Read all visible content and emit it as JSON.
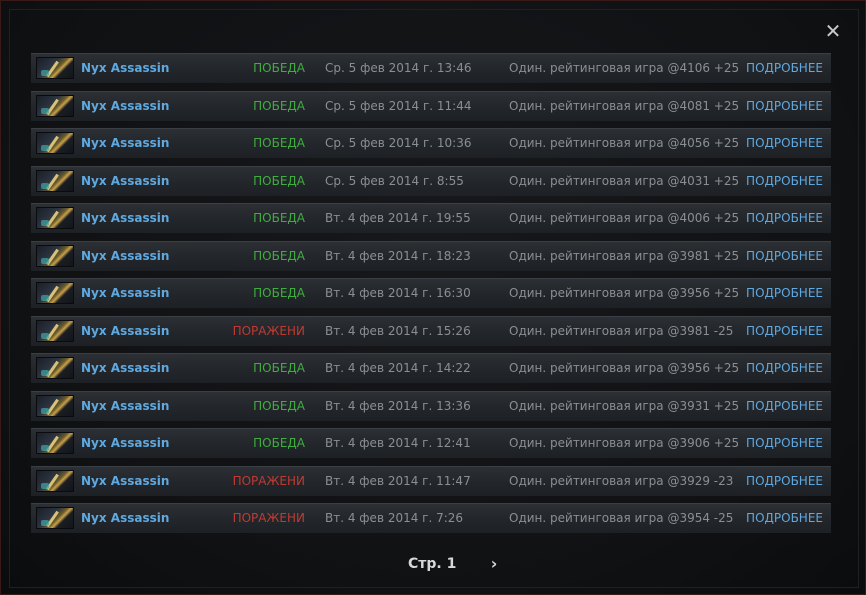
{
  "close_icon": "close-icon",
  "matches": [
    {
      "hero": "Nyx Assassin",
      "result": "ПОБЕДА",
      "outcome": "win",
      "date": "Ср. 5 фев 2014 г. 13:46",
      "mode": "Один. рейтинговая игра @4106 +25",
      "details": "ПОДРОБНЕЕ"
    },
    {
      "hero": "Nyx Assassin",
      "result": "ПОБЕДА",
      "outcome": "win",
      "date": "Ср. 5 фев 2014 г. 11:44",
      "mode": "Один. рейтинговая игра @4081 +25",
      "details": "ПОДРОБНЕЕ"
    },
    {
      "hero": "Nyx Assassin",
      "result": "ПОБЕДА",
      "outcome": "win",
      "date": "Ср. 5 фев 2014 г. 10:36",
      "mode": "Один. рейтинговая игра @4056 +25",
      "details": "ПОДРОБНЕЕ"
    },
    {
      "hero": "Nyx Assassin",
      "result": "ПОБЕДА",
      "outcome": "win",
      "date": "Ср. 5 фев 2014 г. 8:55",
      "mode": "Один. рейтинговая игра @4031 +25",
      "details": "ПОДРОБНЕЕ"
    },
    {
      "hero": "Nyx Assassin",
      "result": "ПОБЕДА",
      "outcome": "win",
      "date": "Вт. 4 фев 2014 г. 19:55",
      "mode": "Один. рейтинговая игра @4006 +25",
      "details": "ПОДРОБНЕЕ"
    },
    {
      "hero": "Nyx Assassin",
      "result": "ПОБЕДА",
      "outcome": "win",
      "date": "Вт. 4 фев 2014 г. 18:23",
      "mode": "Один. рейтинговая игра @3981 +25",
      "details": "ПОДРОБНЕЕ"
    },
    {
      "hero": "Nyx Assassin",
      "result": "ПОБЕДА",
      "outcome": "win",
      "date": "Вт. 4 фев 2014 г. 16:30",
      "mode": "Один. рейтинговая игра @3956 +25",
      "details": "ПОДРОБНЕЕ"
    },
    {
      "hero": "Nyx Assassin",
      "result": "ПОРАЖЕНИ",
      "outcome": "loss",
      "date": "Вт. 4 фев 2014 г. 15:26",
      "mode": "Один. рейтинговая игра @3981 -25",
      "details": "ПОДРОБНЕЕ"
    },
    {
      "hero": "Nyx Assassin",
      "result": "ПОБЕДА",
      "outcome": "win",
      "date": "Вт. 4 фев 2014 г. 14:22",
      "mode": "Один. рейтинговая игра @3956 +25",
      "details": "ПОДРОБНЕЕ"
    },
    {
      "hero": "Nyx Assassin",
      "result": "ПОБЕДА",
      "outcome": "win",
      "date": "Вт. 4 фев 2014 г. 13:36",
      "mode": "Один. рейтинговая игра @3931 +25",
      "details": "ПОДРОБНЕЕ"
    },
    {
      "hero": "Nyx Assassin",
      "result": "ПОБЕДА",
      "outcome": "win",
      "date": "Вт. 4 фев 2014 г. 12:41",
      "mode": "Один. рейтинговая игра @3906 +25",
      "details": "ПОДРОБНЕЕ"
    },
    {
      "hero": "Nyx Assassin",
      "result": "ПОРАЖЕНИ",
      "outcome": "loss",
      "date": "Вт. 4 фев 2014 г. 11:47",
      "mode": "Один. рейтинговая игра @3929 -23",
      "details": "ПОДРОБНЕЕ"
    },
    {
      "hero": "Nyx Assassin",
      "result": "ПОРАЖЕНИ",
      "outcome": "loss",
      "date": "Вт. 4 фев 2014 г. 7:26",
      "mode": "Один. рейтинговая игра @3954 -25",
      "details": "ПОДРОБНЕЕ"
    }
  ],
  "pager": {
    "label": "Стр. 1",
    "next_icon": "chevron-right-icon"
  },
  "colors": {
    "win": "#3fae3f",
    "loss": "#c03a32",
    "link": "#5fa8e0"
  }
}
